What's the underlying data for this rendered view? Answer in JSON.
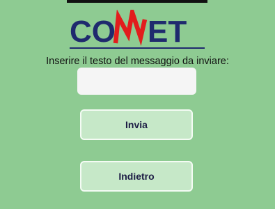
{
  "logo": {
    "brand": "CONNET",
    "color_blue": "#1f2a6e",
    "color_red": "#e21d1d"
  },
  "prompt": {
    "label": "Inserire il testo del messaggio da inviare:"
  },
  "message_input": {
    "value": "",
    "placeholder": ""
  },
  "buttons": {
    "send_label": "Invia",
    "back_label": "Indietro"
  },
  "colors": {
    "background": "#8ecb92",
    "button_fill": "#c6e8c8",
    "button_text": "#1c1c44"
  }
}
